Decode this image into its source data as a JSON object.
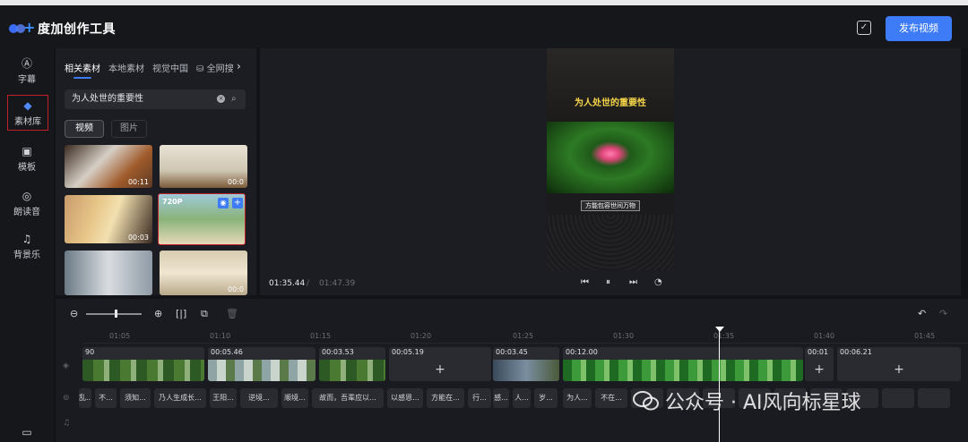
{
  "app": {
    "title": "度加创作工具",
    "publish_label": "发布视频"
  },
  "sidebar": {
    "items": [
      {
        "label": "字幕",
        "icon": "caption-icon"
      },
      {
        "label": "素材库",
        "icon": "layers-icon"
      },
      {
        "label": "模板",
        "icon": "template-icon"
      },
      {
        "label": "朗读音",
        "icon": "voice-icon"
      },
      {
        "label": "背景乐",
        "icon": "music-icon"
      }
    ]
  },
  "material": {
    "tabs": [
      "相关素材",
      "本地素材",
      "视觉中国",
      "全网搜"
    ],
    "search_value": "为人处世的重要性",
    "filters": {
      "video": "视频",
      "image": "图片"
    },
    "thumbs": [
      {
        "duration": "00:11"
      },
      {
        "duration": "00:0"
      },
      {
        "duration": "00:03"
      },
      {
        "quality": "720P"
      },
      {
        "duration": ""
      },
      {
        "duration": "00:0"
      }
    ]
  },
  "player": {
    "caption_top": "为人处世的重要性",
    "caption_bottom": "方能包容世间万物",
    "time_current": "01:35.44",
    "time_separator": "/",
    "time_total": "01:47.39"
  },
  "timeline": {
    "ticks": [
      "01:05",
      "01:10",
      "01:15",
      "01:20",
      "01:25",
      "01:30",
      "01:35",
      "01:40",
      "01:45"
    ],
    "clips": [
      {
        "label": "90"
      },
      {
        "label": "00:05.46"
      },
      {
        "label": "00:03.53"
      },
      {
        "label": "00:05.19"
      },
      {
        "label": "00:03.45"
      },
      {
        "label": "00:12.00"
      },
      {
        "label": "00:01"
      },
      {
        "label": "00:06.21"
      }
    ],
    "subtitles": [
      "乱...",
      "不...",
      "须知...",
      "乃人生成长...",
      "王阳...",
      "逆境...",
      "顺境...",
      "故而，吾辈应以...",
      "以感恩...",
      "方能在...",
      "行...",
      "感...",
      "人...",
      "岁...",
      "为人...",
      "不在...",
      "",
      "",
      "",
      "",
      "",
      "",
      "",
      "",
      ""
    ]
  },
  "watermark": {
    "text": "公众号 · AI风向标星球"
  }
}
